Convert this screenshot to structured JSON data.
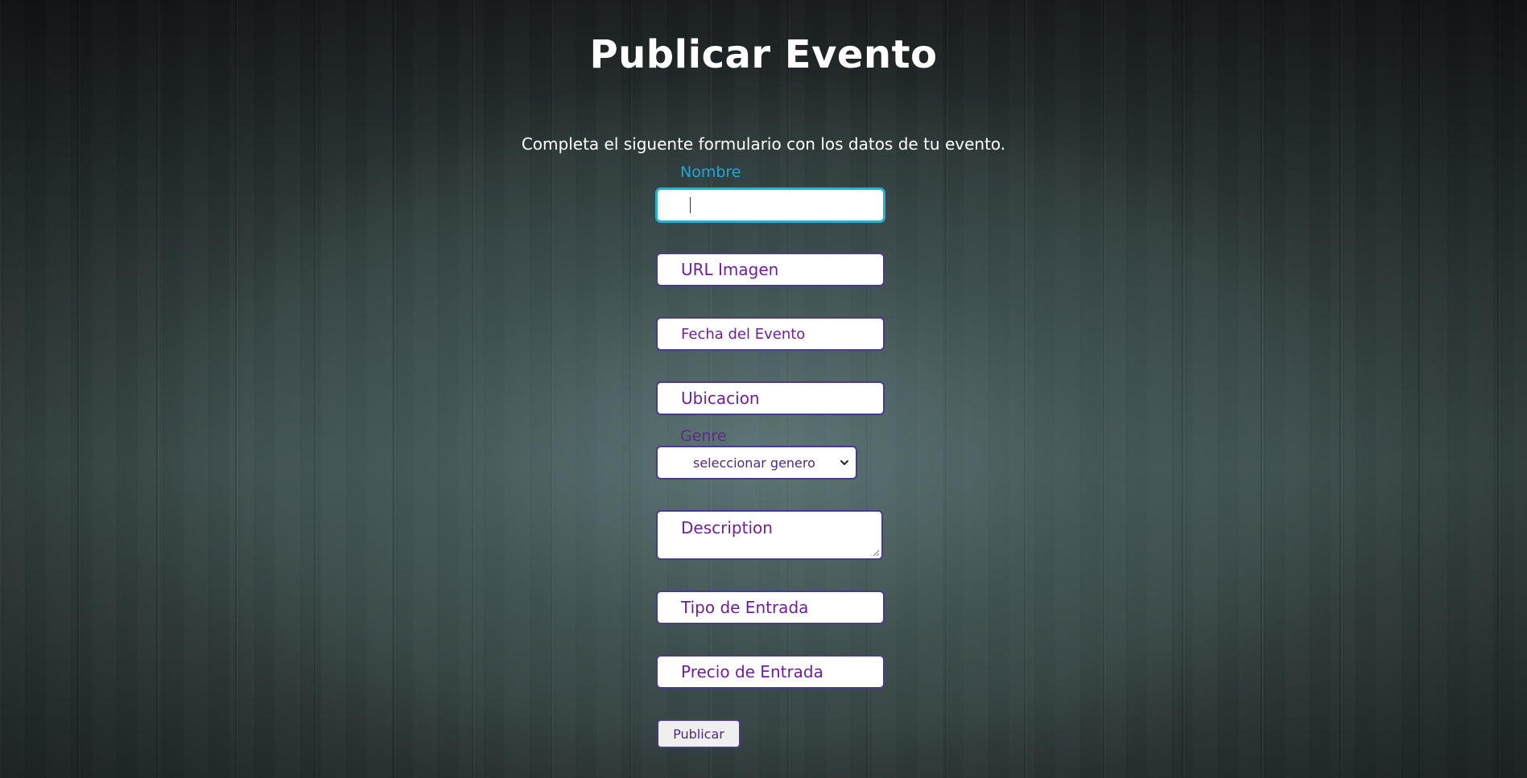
{
  "page": {
    "title": "Publicar Evento",
    "intro": "Completa el siguente formulario con los datos de tu evento."
  },
  "form": {
    "nombre": {
      "label": "Nombre",
      "value": ""
    },
    "url_imagen": {
      "placeholder": "URL Imagen",
      "value": ""
    },
    "fecha": {
      "placeholder": "Fecha del Evento",
      "value": ""
    },
    "ubicacion": {
      "placeholder": "Ubicacion",
      "value": ""
    },
    "genre": {
      "label": "Genre",
      "selected": "seleccionar genero"
    },
    "description": {
      "placeholder": "Description",
      "value": ""
    },
    "tipo_entrada": {
      "placeholder": "Tipo de Entrada",
      "value": ""
    },
    "precio_entrada": {
      "placeholder": "Precio de Entrada",
      "value": ""
    },
    "submit_label": "Publicar"
  },
  "icons": {
    "select_arrow": "chevron-down-icon",
    "textarea_resize": "resize-grip-icon"
  },
  "colors": {
    "title_text": "#ffffff",
    "focus_label": "#22a6d6",
    "focus_border": "#22b3cf",
    "field_border": "#4a3a8c",
    "placeholder_text": "#6b1f9a"
  }
}
